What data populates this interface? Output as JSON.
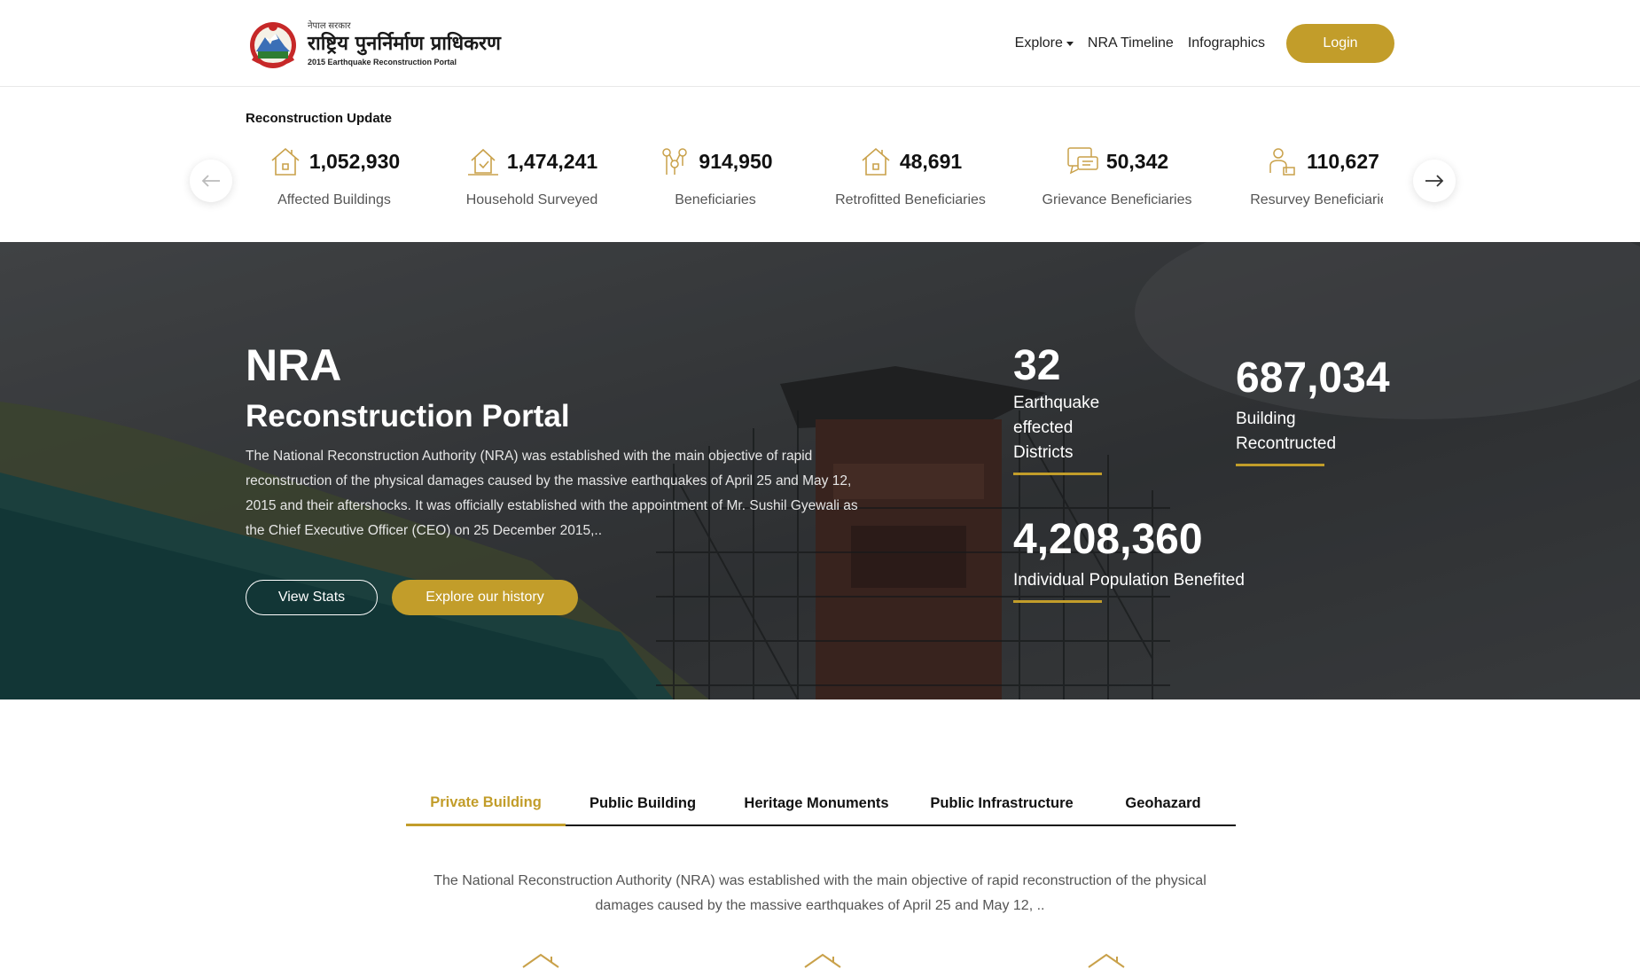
{
  "header": {
    "logo_small": "नेपाल सरकार",
    "logo_big": "राष्ट्रिय पुनर्निर्माण प्राधिकरण",
    "logo_sub": "2015 Earthquake Reconstruction Portal",
    "nav": [
      {
        "label": "Explore",
        "dropdown": true
      },
      {
        "label": "NRA Timeline"
      },
      {
        "label": "Infographics"
      }
    ],
    "login_label": "Login"
  },
  "strip": {
    "title": "Reconstruction Update",
    "prev_icon": "arrow-left-icon",
    "next_icon": "arrow-right-icon",
    "stats": [
      {
        "value": "1,052,930",
        "label": "Affected Buildings",
        "icon": "house-icon"
      },
      {
        "value": "1,474,241",
        "label": "Household Surveyed",
        "icon": "survey-house-icon"
      },
      {
        "value": "914,950",
        "label": "Beneficiaries",
        "icon": "people-network-icon"
      },
      {
        "value": "48,691",
        "label": "Retrofitted Beneficiaries",
        "icon": "house-icon"
      },
      {
        "value": "50,342",
        "label": "Grievance Beneficiaries",
        "icon": "grievance-chat-icon"
      },
      {
        "value": "110,627",
        "label": "Resurvey Beneficiaries",
        "icon": "resurvey-person-icon"
      }
    ]
  },
  "hero": {
    "title": "NRA",
    "subtitle": "Reconstruction Portal",
    "description": "The National Reconstruction Authority (NRA) was established with the main objective of rapid reconstruction of the physical damages caused by the massive earthquakes of April 25 and May 12, 2015 and their aftershocks. It was officially established with the appointment of Mr. Sushil Gyewali as the Chief Executive Officer (CEO) on 25 December 2015,..",
    "btn_view_stats": "View Stats",
    "btn_explore_history": "Explore our history",
    "stats": [
      {
        "value": "32",
        "label": [
          "Earthquake",
          "effected",
          "Districts"
        ]
      },
      {
        "value": "687,034",
        "label": [
          "Building",
          "Recontructed"
        ]
      },
      {
        "value": "4,208,360",
        "label": [
          "Individual Population Benefited"
        ]
      }
    ]
  },
  "tabs": {
    "items": [
      "Private Building",
      "Public Building",
      "Heritage Monuments",
      "Public Infrastructure",
      "Geohazard"
    ],
    "active": "Private Building",
    "description": "The National Reconstruction Authority (NRA) was established with the main objective of rapid reconstruction of the physical damages caused by the massive earthquakes of April 25 and May 12, .."
  },
  "colors": {
    "accent": "#c29d2a",
    "text_dark": "#111111",
    "text_muted": "#555555"
  }
}
